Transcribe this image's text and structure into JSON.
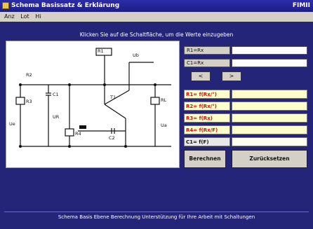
{
  "window": {
    "title": "Schema Basissatz & Erklärung",
    "title_right": "FIMII"
  },
  "menu": [
    "Anz",
    "Lot",
    "Hi"
  ],
  "heading": "Klicken Sie auf die Schaltfläche, um die Werte einzugeben",
  "circuit_labels": {
    "r1": "R1",
    "r2": "R2",
    "r3": "R3",
    "r4": "R4",
    "c1": "C1",
    "c2": "C2",
    "ua": "Ua",
    "ue": "Ue",
    "ub": "Ub",
    "t1": "T1",
    "rl": "RL",
    "ur": "UR"
  },
  "inputs": [
    {
      "label": "R1=Rx",
      "value": ""
    },
    {
      "label": "C1=Rx",
      "value": ""
    }
  ],
  "stepper": {
    "prev": "<",
    "next": ">"
  },
  "results": [
    {
      "label": "R1= f(Rx/°)",
      "value": "",
      "style": "red"
    },
    {
      "label": "R2= f(Rx/°)",
      "value": "",
      "style": "red"
    },
    {
      "label": "R3= f(Rx)",
      "value": "",
      "style": "red"
    },
    {
      "label": "R4= f(Rx/F)",
      "value": "",
      "style": "red"
    },
    {
      "label": "C1= f(F)",
      "value": "",
      "style": "dark"
    }
  ],
  "buttons": {
    "calculate": "Berechnen",
    "clear": "Zurücksetzen"
  },
  "footer": "Schema Basis Ebene Berechnung Unterstützung für Ihre Arbeit mit Schaltungen"
}
